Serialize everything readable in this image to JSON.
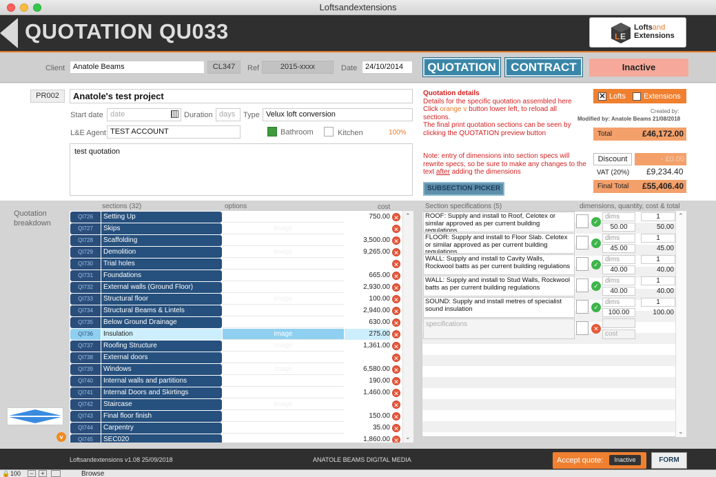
{
  "window": {
    "title": "Loftsandextensions"
  },
  "header": {
    "title": "QUOTATION QU033",
    "logo_line1": "Lofts",
    "logo_and": "and",
    "logo_line2": "Extensions"
  },
  "client": {
    "label": "Client",
    "value": "Anatole Beams",
    "code": "CL347",
    "ref_label": "Ref",
    "ref_value": "2015-xxxx",
    "date_label": "Date",
    "date_value": "24/10/2014"
  },
  "actions": {
    "quotation": "QUOTATION",
    "contract": "CONTRACT",
    "status": "Inactive"
  },
  "project": {
    "code": "PR002",
    "name": "Anatole's test project",
    "start_label": "Start date",
    "start_placeholder": "date",
    "duration_label": "Duration",
    "duration_placeholder": "days",
    "type_label": "Type",
    "type_value": "Velux loft conversion",
    "agent_label": "L&E Agent",
    "agent_value": "TEST ACCOUNT",
    "bathroom_label": "Bathroom",
    "kitchen_label": "Kitchen",
    "percent": "100%",
    "notes": "test quotation"
  },
  "info": {
    "heading": "Quotation details",
    "line1": "Details for the specific quotation assembled here",
    "line2a": "Click ",
    "line2b": "orange v",
    "line2c": " button lower left, to reload all",
    "line3": "sections.",
    "line4": "The final print quotation sections can be seen by",
    "line5": "clicking the QUOTATION preview button",
    "note1": "Note: entry of dimensions into section specs will",
    "note2": "rewrite specs, so be sure to make any changes to the",
    "note3a": "text ",
    "note3b": "after",
    "note3c": " adding the dimensions",
    "subsection_btn": "SUBSECTION PICKER"
  },
  "summary": {
    "lofts_label": "Lofts",
    "extensions_label": "Extensions",
    "created_by": "Created by:",
    "modified_by": "Modified by: Anatole Beams 21/08/2018",
    "total_label": "Total",
    "total_value": "£46,172.00",
    "discount_label": "Discount",
    "discount_value": "- £0.00",
    "vat_label": "VAT (20%)",
    "vat_value": "£9,234.40",
    "final_label": "Final Total",
    "final_value": "£55,406.40"
  },
  "breakdown": {
    "label1": "Quotation",
    "label2": "breakdown",
    "col_sections": "sections (32)",
    "col_options": "options",
    "col_cost": "cost",
    "rows": [
      {
        "code": "QI726",
        "name": "Setting Up",
        "opt": "",
        "cost": "750.00"
      },
      {
        "code": "QI727",
        "name": "Skips",
        "opt": "image",
        "cost": ""
      },
      {
        "code": "QI728",
        "name": "Scaffolding",
        "opt": "",
        "cost": "3,500.00"
      },
      {
        "code": "QI729",
        "name": "Demolition",
        "opt": "image",
        "cost": "9,265.00"
      },
      {
        "code": "QI730",
        "name": "Trial holes",
        "opt": "",
        "cost": ""
      },
      {
        "code": "QI731",
        "name": "Foundations",
        "opt": "",
        "cost": "665.00"
      },
      {
        "code": "QI732",
        "name": "External walls (Ground Floor)",
        "opt": "",
        "cost": "2,930.00"
      },
      {
        "code": "QI733",
        "name": "Structural floor",
        "opt": "image",
        "cost": "100.00"
      },
      {
        "code": "QI734",
        "name": "Structural Beams & Lintels",
        "opt": "",
        "cost": "2,940.00"
      },
      {
        "code": "QI735",
        "name": "Below Ground Drainage",
        "opt": "",
        "cost": "630.00"
      },
      {
        "code": "QI736",
        "name": "Insulation",
        "opt": "image",
        "cost": "275.00"
      },
      {
        "code": "QI737",
        "name": "Roofing Structure",
        "opt": "image",
        "cost": "1,361.00"
      },
      {
        "code": "QI738",
        "name": "External doors",
        "opt": "",
        "cost": ""
      },
      {
        "code": "QI739",
        "name": "Windows",
        "opt": "image",
        "cost": "6,580.00"
      },
      {
        "code": "QI740",
        "name": "Internal walls and partitions",
        "opt": "",
        "cost": "190.00"
      },
      {
        "code": "QI741",
        "name": "Internal Doors and Skirtings",
        "opt": "",
        "cost": "1,460.00"
      },
      {
        "code": "QI742",
        "name": "Staircase",
        "opt": "image",
        "cost": ""
      },
      {
        "code": "QI743",
        "name": "Final floor finish",
        "opt": "",
        "cost": "150.00"
      },
      {
        "code": "QI744",
        "name": "Carpentry",
        "opt": "",
        "cost": "35.00"
      },
      {
        "code": "QI745",
        "name": "SEC020",
        "opt": "",
        "cost": "1,860.00"
      }
    ]
  },
  "specs": {
    "title": "Section specifications (5)",
    "col_right": "dimensions, quantity, cost & total",
    "dims_placeholder": "dims",
    "rows": [
      {
        "text": "ROOF: Supply and install to Roof, Celotex or similar approved as per current building regulations",
        "qty": "1",
        "dimval": "50.00",
        "total": "50.00"
      },
      {
        "text": "FLOOR: Supply and install to Floor Slab. Celotex or similar approved as per current building regulations",
        "qty": "1",
        "dimval": "45.00",
        "total": "45.00"
      },
      {
        "text": "WALL: Supply and install to Cavity Walls, Rockwool batts as per current building regulations",
        "qty": "1",
        "dimval": "40.00",
        "total": "40.00"
      },
      {
        "text": "WALL: Supply and install to Stud Walls, Rockwool batts as per current building regulations",
        "qty": "1",
        "dimval": "40.00",
        "total": "40.00"
      },
      {
        "text": "SOUND: Supply and install metres of specialist sound insulation",
        "qty": "1",
        "dimval": "100.00",
        "total": "100.00"
      }
    ],
    "new_placeholder": "specifications",
    "cost_placeholder": "cost"
  },
  "footer": {
    "version": "Loftsandextensions  v1.08 25/09/2018",
    "company": "ANATOLE BEAMS DIGITAL MEDIA",
    "accept_label": "Accept quote:",
    "accept_value": "Inactive",
    "form_btn": "FORM"
  },
  "statusbar": {
    "zoom": "100",
    "mode": "Browse"
  }
}
